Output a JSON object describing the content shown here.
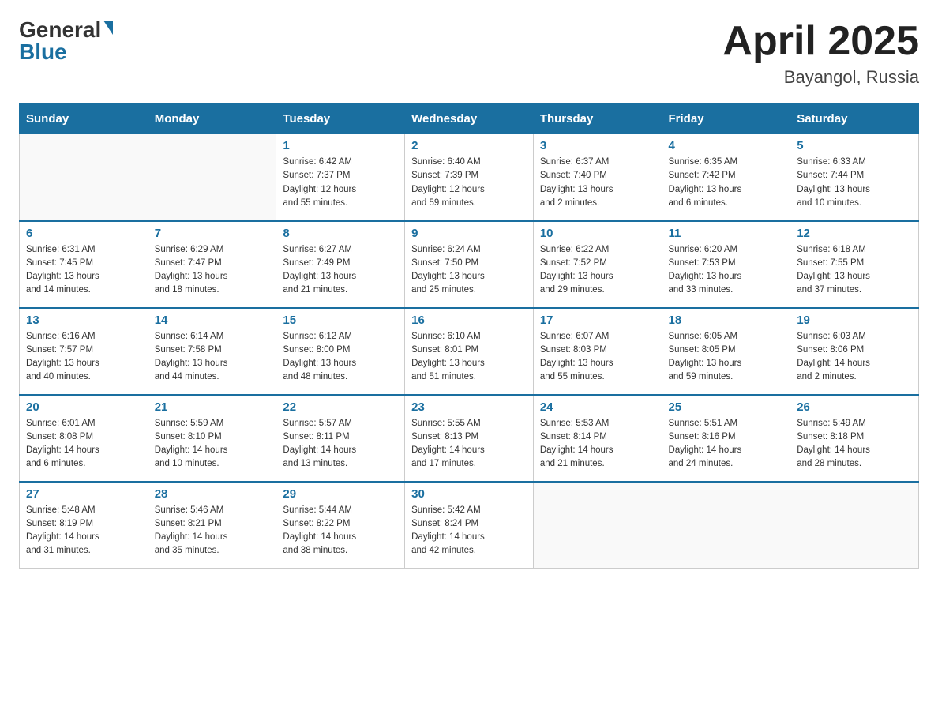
{
  "header": {
    "logo_general": "General",
    "logo_blue": "Blue",
    "month_title": "April 2025",
    "location": "Bayangol, Russia"
  },
  "weekdays": [
    "Sunday",
    "Monday",
    "Tuesday",
    "Wednesday",
    "Thursday",
    "Friday",
    "Saturday"
  ],
  "weeks": [
    [
      {
        "day": "",
        "info": ""
      },
      {
        "day": "",
        "info": ""
      },
      {
        "day": "1",
        "info": "Sunrise: 6:42 AM\nSunset: 7:37 PM\nDaylight: 12 hours\nand 55 minutes."
      },
      {
        "day": "2",
        "info": "Sunrise: 6:40 AM\nSunset: 7:39 PM\nDaylight: 12 hours\nand 59 minutes."
      },
      {
        "day": "3",
        "info": "Sunrise: 6:37 AM\nSunset: 7:40 PM\nDaylight: 13 hours\nand 2 minutes."
      },
      {
        "day": "4",
        "info": "Sunrise: 6:35 AM\nSunset: 7:42 PM\nDaylight: 13 hours\nand 6 minutes."
      },
      {
        "day": "5",
        "info": "Sunrise: 6:33 AM\nSunset: 7:44 PM\nDaylight: 13 hours\nand 10 minutes."
      }
    ],
    [
      {
        "day": "6",
        "info": "Sunrise: 6:31 AM\nSunset: 7:45 PM\nDaylight: 13 hours\nand 14 minutes."
      },
      {
        "day": "7",
        "info": "Sunrise: 6:29 AM\nSunset: 7:47 PM\nDaylight: 13 hours\nand 18 minutes."
      },
      {
        "day": "8",
        "info": "Sunrise: 6:27 AM\nSunset: 7:49 PM\nDaylight: 13 hours\nand 21 minutes."
      },
      {
        "day": "9",
        "info": "Sunrise: 6:24 AM\nSunset: 7:50 PM\nDaylight: 13 hours\nand 25 minutes."
      },
      {
        "day": "10",
        "info": "Sunrise: 6:22 AM\nSunset: 7:52 PM\nDaylight: 13 hours\nand 29 minutes."
      },
      {
        "day": "11",
        "info": "Sunrise: 6:20 AM\nSunset: 7:53 PM\nDaylight: 13 hours\nand 33 minutes."
      },
      {
        "day": "12",
        "info": "Sunrise: 6:18 AM\nSunset: 7:55 PM\nDaylight: 13 hours\nand 37 minutes."
      }
    ],
    [
      {
        "day": "13",
        "info": "Sunrise: 6:16 AM\nSunset: 7:57 PM\nDaylight: 13 hours\nand 40 minutes."
      },
      {
        "day": "14",
        "info": "Sunrise: 6:14 AM\nSunset: 7:58 PM\nDaylight: 13 hours\nand 44 minutes."
      },
      {
        "day": "15",
        "info": "Sunrise: 6:12 AM\nSunset: 8:00 PM\nDaylight: 13 hours\nand 48 minutes."
      },
      {
        "day": "16",
        "info": "Sunrise: 6:10 AM\nSunset: 8:01 PM\nDaylight: 13 hours\nand 51 minutes."
      },
      {
        "day": "17",
        "info": "Sunrise: 6:07 AM\nSunset: 8:03 PM\nDaylight: 13 hours\nand 55 minutes."
      },
      {
        "day": "18",
        "info": "Sunrise: 6:05 AM\nSunset: 8:05 PM\nDaylight: 13 hours\nand 59 minutes."
      },
      {
        "day": "19",
        "info": "Sunrise: 6:03 AM\nSunset: 8:06 PM\nDaylight: 14 hours\nand 2 minutes."
      }
    ],
    [
      {
        "day": "20",
        "info": "Sunrise: 6:01 AM\nSunset: 8:08 PM\nDaylight: 14 hours\nand 6 minutes."
      },
      {
        "day": "21",
        "info": "Sunrise: 5:59 AM\nSunset: 8:10 PM\nDaylight: 14 hours\nand 10 minutes."
      },
      {
        "day": "22",
        "info": "Sunrise: 5:57 AM\nSunset: 8:11 PM\nDaylight: 14 hours\nand 13 minutes."
      },
      {
        "day": "23",
        "info": "Sunrise: 5:55 AM\nSunset: 8:13 PM\nDaylight: 14 hours\nand 17 minutes."
      },
      {
        "day": "24",
        "info": "Sunrise: 5:53 AM\nSunset: 8:14 PM\nDaylight: 14 hours\nand 21 minutes."
      },
      {
        "day": "25",
        "info": "Sunrise: 5:51 AM\nSunset: 8:16 PM\nDaylight: 14 hours\nand 24 minutes."
      },
      {
        "day": "26",
        "info": "Sunrise: 5:49 AM\nSunset: 8:18 PM\nDaylight: 14 hours\nand 28 minutes."
      }
    ],
    [
      {
        "day": "27",
        "info": "Sunrise: 5:48 AM\nSunset: 8:19 PM\nDaylight: 14 hours\nand 31 minutes."
      },
      {
        "day": "28",
        "info": "Sunrise: 5:46 AM\nSunset: 8:21 PM\nDaylight: 14 hours\nand 35 minutes."
      },
      {
        "day": "29",
        "info": "Sunrise: 5:44 AM\nSunset: 8:22 PM\nDaylight: 14 hours\nand 38 minutes."
      },
      {
        "day": "30",
        "info": "Sunrise: 5:42 AM\nSunset: 8:24 PM\nDaylight: 14 hours\nand 42 minutes."
      },
      {
        "day": "",
        "info": ""
      },
      {
        "day": "",
        "info": ""
      },
      {
        "day": "",
        "info": ""
      }
    ]
  ]
}
